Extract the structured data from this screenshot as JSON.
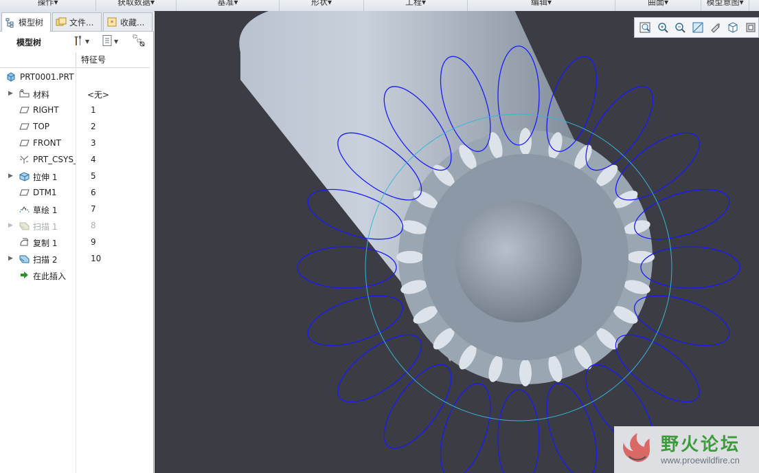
{
  "ribbon": {
    "groups": [
      "操作▾",
      "获取数据▾",
      "基准▾",
      "形状▾",
      "工程▾",
      "编辑▾",
      "曲面▾",
      "模型意图▾"
    ]
  },
  "tabs": [
    {
      "label": "模型树",
      "icon": "model-tree-icon"
    },
    {
      "label": "文件...",
      "icon": "folder-browser-icon"
    },
    {
      "label": "收藏...",
      "icon": "favorites-icon"
    }
  ],
  "tree_toolbar": {
    "title": "模型树"
  },
  "columns": {
    "feature_id": "特征号"
  },
  "tree": {
    "root": "PRT0001.PRT",
    "items": [
      {
        "label": "材料",
        "id": "<无>",
        "expandable": true,
        "icon": "material-icon"
      },
      {
        "label": "RIGHT",
        "id": "1",
        "expandable": false,
        "icon": "datum-plane-icon"
      },
      {
        "label": "TOP",
        "id": "2",
        "expandable": false,
        "icon": "datum-plane-icon"
      },
      {
        "label": "FRONT",
        "id": "3",
        "expandable": false,
        "icon": "datum-plane-icon"
      },
      {
        "label": "PRT_CSYS_",
        "id": "4",
        "expandable": false,
        "icon": "csys-icon"
      },
      {
        "label": "拉伸 1",
        "id": "5",
        "expandable": true,
        "icon": "extrude-icon"
      },
      {
        "label": "DTM1",
        "id": "6",
        "expandable": false,
        "icon": "datum-plane-icon"
      },
      {
        "label": "草绘 1",
        "id": "7",
        "expandable": false,
        "icon": "sketch-icon"
      },
      {
        "label": "扫描 1",
        "id": "8",
        "expandable": true,
        "icon": "sweep-icon",
        "dimmed": true
      },
      {
        "label": "复制 1",
        "id": "9",
        "expandable": false,
        "icon": "copy-icon"
      },
      {
        "label": "扫描 2",
        "id": "10",
        "expandable": true,
        "icon": "sweep-icon"
      },
      {
        "label": "在此插入",
        "id": "",
        "expandable": false,
        "icon": "insert-here-icon"
      }
    ]
  },
  "view_toolbar": [
    "refit-icon",
    "zoom-in-icon",
    "zoom-out-icon",
    "repaint-icon",
    "spin-center-icon",
    "saved-views-icon",
    "display-style-icon"
  ],
  "watermark": {
    "title": "野火论坛",
    "url": "www.proewildfire.cn"
  },
  "colors": {
    "viewport_bg": "#3c3c45",
    "helix": "#1a1aff",
    "circle": "#38b6d6",
    "part": "#a9b3c0"
  }
}
